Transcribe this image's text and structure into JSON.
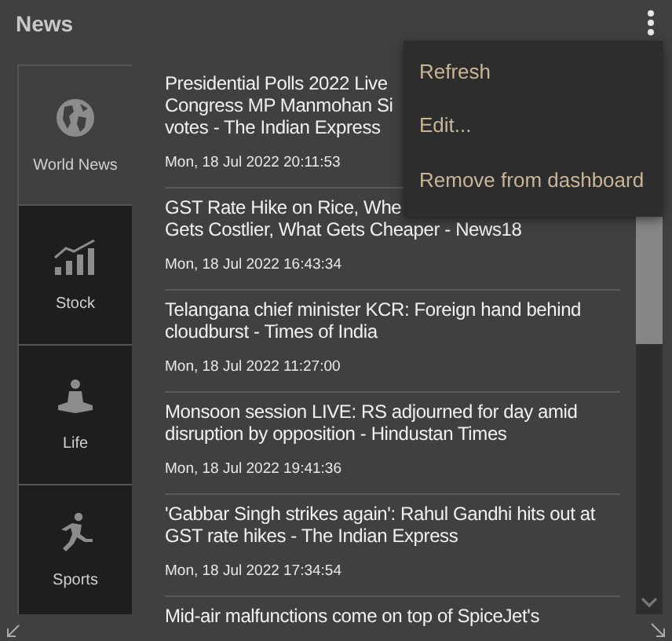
{
  "title": "News",
  "menu": [
    {
      "label": "Refresh"
    },
    {
      "label": "Edit..."
    },
    {
      "label": "Remove from dashboard"
    }
  ],
  "categories": [
    {
      "label": "World News",
      "kind": "globe",
      "selected": true
    },
    {
      "label": "Stock",
      "kind": "chart",
      "selected": false
    },
    {
      "label": "Life",
      "kind": "meditation",
      "selected": false
    },
    {
      "label": "Sports",
      "kind": "running",
      "selected": false
    }
  ],
  "articles": [
    {
      "lines": [
        "Presidential Polls 2022 Live",
        "Congress MP Manmohan Si",
        "votes - The Indian Express"
      ],
      "date": "Mon, 18 Jul 2022 20:11:53"
    },
    {
      "lines": [
        "GST Rate Hike on Rice, Whe",
        "Gets Costlier, What Gets Cheaper - News18"
      ],
      "date": "Mon, 18 Jul 2022 16:43:34"
    },
    {
      "lines": [
        "Telangana chief minister KCR: Foreign hand behind",
        "cloudburst - Times of India"
      ],
      "date": "Mon, 18 Jul 2022 11:27:00"
    },
    {
      "lines": [
        "Monsoon session LIVE: RS adjourned for day amid",
        "disruption by opposition - Hindustan Times"
      ],
      "date": "Mon, 18 Jul 2022 19:41:36"
    },
    {
      "lines": [
        "'Gabbar Singh strikes again': Rahul Gandhi hits out at",
        "GST rate hikes - The Indian Express"
      ],
      "date": "Mon, 18 Jul 2022 17:34:54"
    },
    {
      "lines": [
        "Mid-air malfunctions come on top of SpiceJet's"
      ]
    }
  ]
}
